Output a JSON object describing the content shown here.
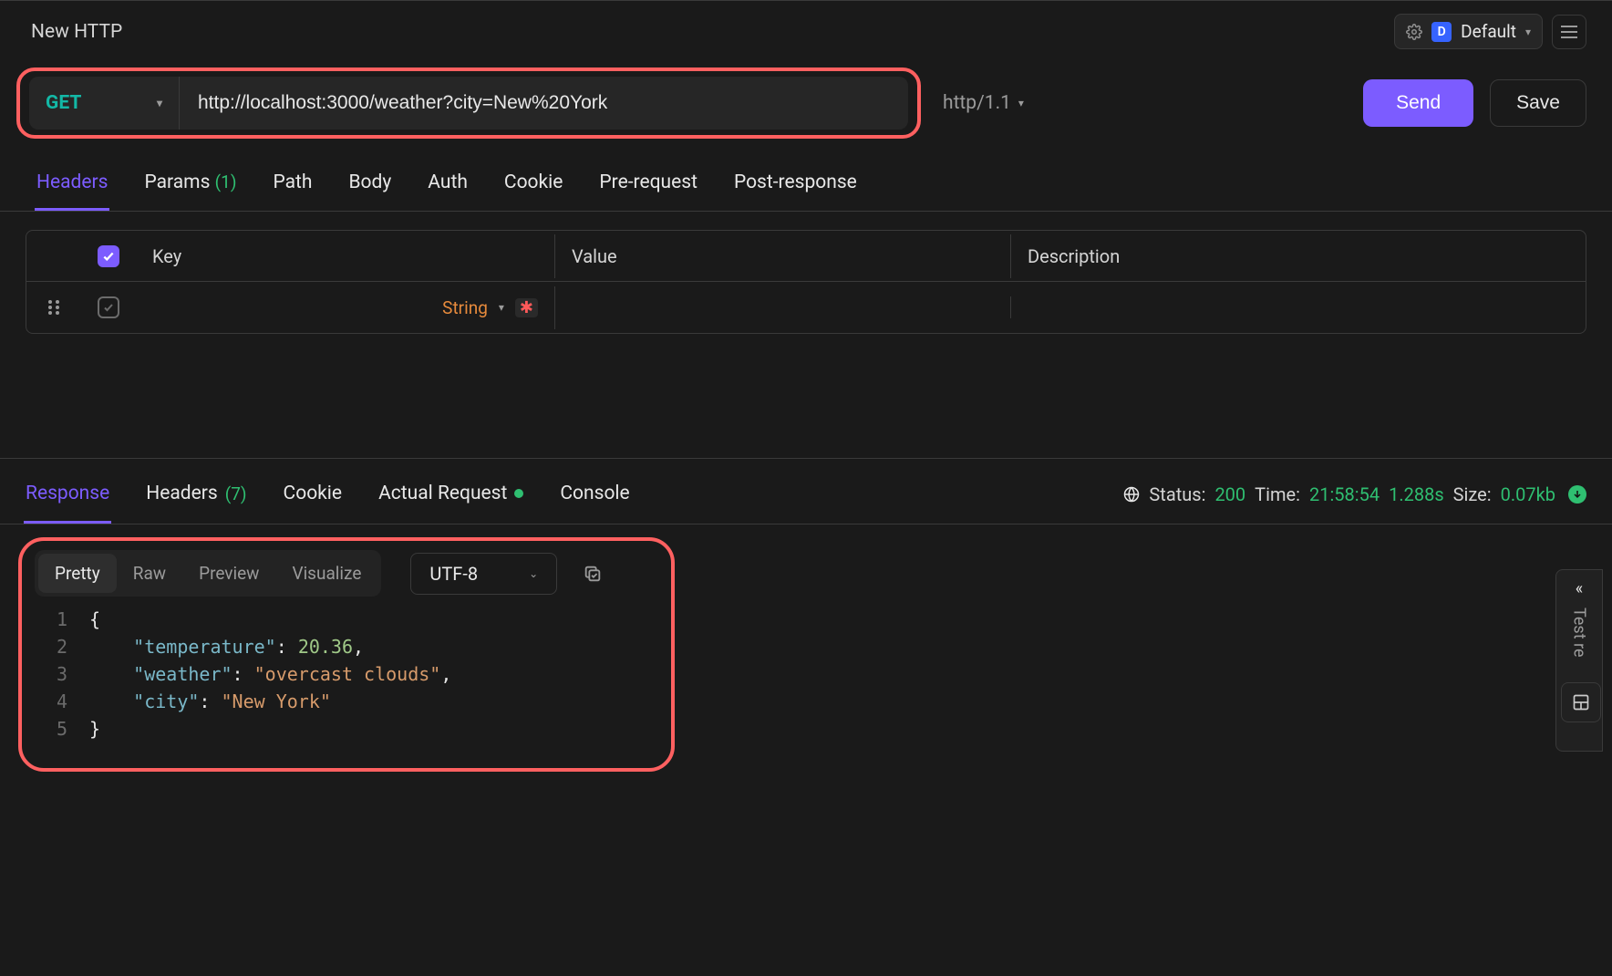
{
  "title": "New HTTP",
  "env": {
    "label": "Default",
    "badge": "D"
  },
  "request": {
    "method": "GET",
    "url": "http://localhost:3000/weather?city=New%20York",
    "protocol": "http/1.1",
    "send": "Send",
    "save": "Save"
  },
  "req_tabs": {
    "headers": "Headers",
    "params": "Params",
    "params_count": "(1)",
    "path": "Path",
    "body": "Body",
    "auth": "Auth",
    "cookie": "Cookie",
    "prereq": "Pre-request",
    "postres": "Post-response"
  },
  "headers_table": {
    "col_key": "Key",
    "col_value": "Value",
    "col_desc": "Description",
    "row_type": "String"
  },
  "resp_tabs": {
    "response": "Response",
    "headers": "Headers",
    "headers_count": "(7)",
    "cookie": "Cookie",
    "actual": "Actual Request",
    "console": "Console"
  },
  "status": {
    "status_label": "Status:",
    "status_code": "200",
    "time_label": "Time:",
    "time_clock": "21:58:54",
    "duration": "1.288s",
    "size_label": "Size:",
    "size_value": "0.07kb"
  },
  "view_tabs": {
    "pretty": "Pretty",
    "raw": "Raw",
    "preview": "Preview",
    "visualize": "Visualize",
    "encoding": "UTF-8"
  },
  "code": {
    "l1": "{",
    "l2_key": "\"temperature\"",
    "l2_val": "20.36",
    "l3_key": "\"weather\"",
    "l3_val": "\"overcast clouds\"",
    "l4_key": "\"city\"",
    "l4_val": "\"New York\"",
    "l5": "}",
    "ln1": "1",
    "ln2": "2",
    "ln3": "3",
    "ln4": "4",
    "ln5": "5"
  },
  "side": {
    "collapse": "«",
    "label": "Test re"
  }
}
